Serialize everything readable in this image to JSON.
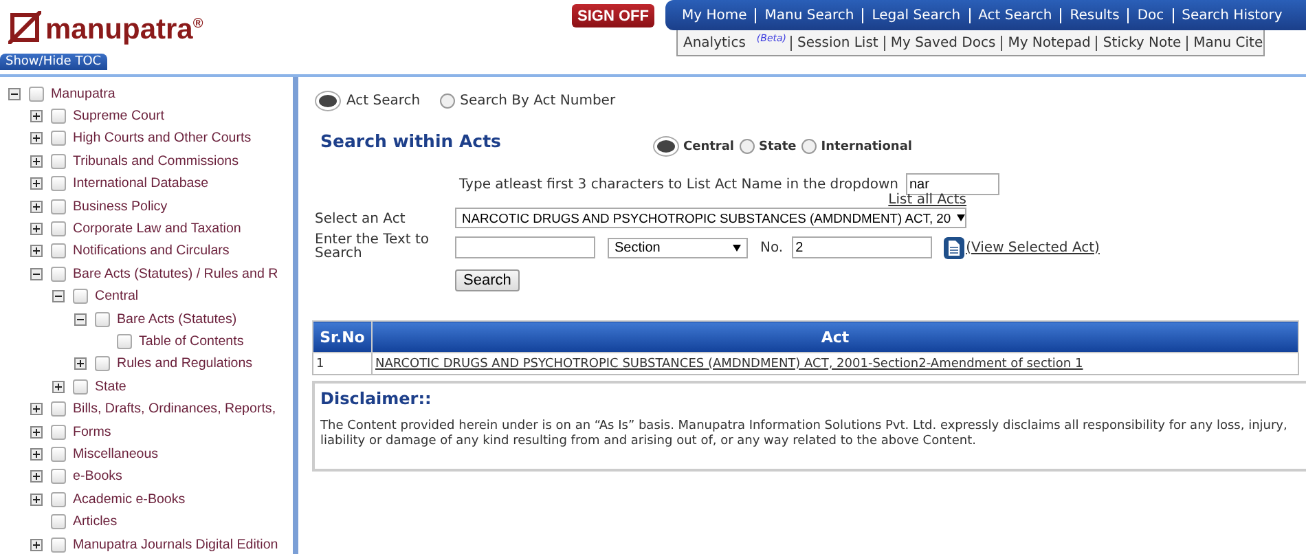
{
  "header": {
    "logo": "manupatra$^{®}$",
    "sign_off": "SIGN OFF",
    "nav": [
      {
        "label": "My Home",
        "selected": false
      },
      {
        "label": "Manu Search",
        "selected": false
      },
      {
        "label": "Legal Search",
        "selected": false
      },
      {
        "label": "Act Search",
        "selected": false
      },
      {
        "label": "Results",
        "selected": false
      },
      {
        "label": "Doc",
        "selected": false
      },
      {
        "label": "Search History",
        "selected": false
      }
    ],
    "subnav": [
      {
        "label": "Analytics",
        "badge": "(Beta)"
      },
      {
        "label": "Session List"
      },
      {
        "label": "My Saved Docs"
      },
      {
        "label": "My Notepad"
      },
      {
        "label": "Sticky Note"
      },
      {
        "label": "Manu Cite"
      }
    ],
    "toc_button": "Show/Hide TOC"
  },
  "sidebar": {
    "tree": [
      {
        "label": "Manupatra",
        "expanded": true,
        "checked": false,
        "children": [
          {
            "label": "Supreme Court",
            "expanded": false,
            "checked": false
          },
          {
            "label": "High Courts and Other Courts",
            "expanded": false,
            "checked": false
          },
          {
            "label": "Tribunals and Commissions",
            "expanded": false,
            "checked": false
          },
          {
            "label": "International Database",
            "expanded": false,
            "checked": false
          },
          {
            "label": "Business Policy",
            "expanded": false,
            "checked": false
          },
          {
            "label": "Corporate Law and Taxation",
            "expanded": false,
            "checked": false
          },
          {
            "label": "Notifications and Circulars",
            "expanded": false,
            "checked": false
          },
          {
            "label": "Bare Acts (Statutes) / Rules and R",
            "expanded": true,
            "checked": false,
            "children": [
              {
                "label": "Central",
                "expanded": true,
                "checked": false,
                "children": [
                  {
                    "label": "Bare Acts (Statutes)",
                    "expanded": true,
                    "checked": false,
                    "children": [
                      {
                        "label": "Table of Contents",
                        "checked": false
                      }
                    ]
                  },
                  {
                    "label": "Rules and Regulations",
                    "expanded": false,
                    "checked": false
                  }
                ]
              },
              {
                "label": "State",
                "expanded": false,
                "checked": false
              }
            ]
          },
          {
            "label": "Bills, Drafts, Ordinances, Reports,",
            "expanded": false,
            "checked": false
          },
          {
            "label": "Forms",
            "expanded": false,
            "checked": false
          },
          {
            "label": "Miscellaneous",
            "expanded": false,
            "checked": false
          },
          {
            "label": "e-Books",
            "expanded": false,
            "checked": false
          },
          {
            "label": "Academic e-Books",
            "expanded": false,
            "checked": false
          },
          {
            "label": "Articles",
            "checked": false
          },
          {
            "label": "Manupatra Journals Digital Edition",
            "expanded": false,
            "checked": false
          }
        ]
      }
    ]
  },
  "search_mode": [
    {
      "label": "Act Search",
      "selected": true
    },
    {
      "label": "Search By Act Number",
      "selected": false
    }
  ],
  "heading": "Search within Acts",
  "scope": [
    {
      "label": "Central",
      "selected": true
    },
    {
      "label": "State",
      "selected": false
    },
    {
      "label": "International",
      "selected": false
    }
  ],
  "form": {
    "hint": "Type atleast first 3 characters to List Act Name in the dropdown",
    "act_filter": "nar",
    "select_label": "Select an Act",
    "act": "NARCOTIC DRUGS AND PSYCHOTROPIC SUBSTANCES (AMDNDMENT) ACT, 20",
    "list_all": "List all Acts",
    "text_label": "Enter the Text to Search",
    "unit": "Section",
    "no_label": "No.",
    "number": "2",
    "view_link": "(View Selected Act)",
    "search_button": "Search"
  },
  "table": {
    "columns": [
      "Sr.No",
      "Act"
    ],
    "rows": [
      [
        "1",
        "NARCOTIC DRUGS AND PSYCHOTROPIC SUBSTANCES (AMDNDMENT) ACT, 2001-Section2-Amendment of section 1"
      ]
    ]
  },
  "disclaimer": {
    "title": "Disclaimer::",
    "text": "The Content provided herein under is on an “As Is” basis. Manupatra Information Solutions Pvt. Ltd. expressly disclaims all responsibility for any loss, injury, liability or damage of any kind resulting from and arising out of, or any way related to the above Content."
  }
}
